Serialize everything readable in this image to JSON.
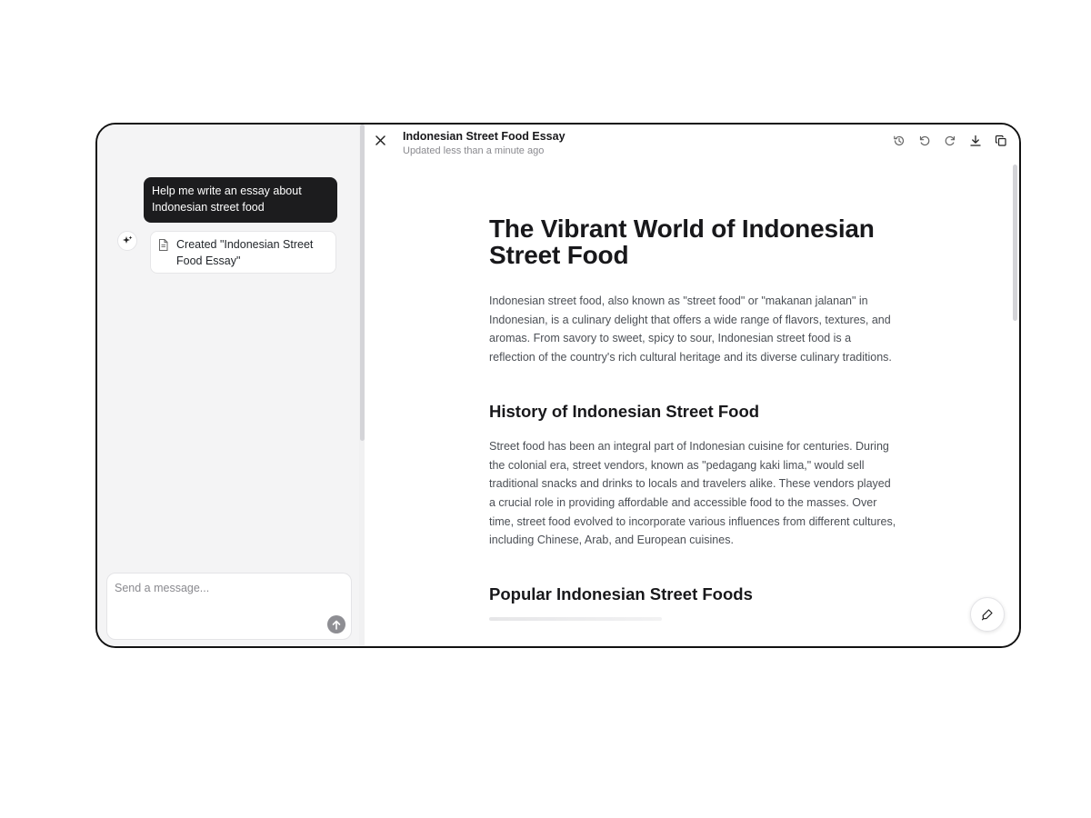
{
  "chat": {
    "user_message": "Help me write an essay about Indonesian street food",
    "artifact_card_label": "Created \"Indonesian Street Food Essay\"",
    "composer_placeholder": "Send a message..."
  },
  "document": {
    "title": "Indonesian Street Food Essay",
    "updated": "Updated less than a minute ago",
    "heading": "The Vibrant World of Indonesian Street Food",
    "sections": [
      {
        "paragraph": "Indonesian street food, also known as \"street food\" or \"makanan jalanan\" in Indonesian, is a culinary delight that offers a wide range of flavors, textures, and aromas. From savory to sweet, spicy to sour, Indonesian street food is a reflection of the country's rich cultural heritage and its diverse culinary traditions."
      },
      {
        "heading": "History of Indonesian Street Food",
        "paragraph": "Street food has been an integral part of Indonesian cuisine for centuries. During the colonial era, street vendors, known as \"pedagang kaki lima,\" would sell traditional snacks and drinks to locals and travelers alike. These vendors played a crucial role in providing affordable and accessible food to the masses. Over time, street food evolved to incorporate various influences from different cultures, including Chinese, Arab, and European cuisines."
      },
      {
        "heading": "Popular Indonesian Street Foods"
      }
    ]
  },
  "icons": {
    "sparkle": "sparkle-icon",
    "document": "document-icon",
    "send": "arrow-up-icon",
    "close": "close-icon",
    "history": "history-icon",
    "undo": "undo-icon",
    "redo": "redo-icon",
    "download": "download-icon",
    "copy": "copy-icon",
    "edit": "pen-icon"
  },
  "colors": {
    "user_bubble": "#1c1c1e",
    "chat_background": "#f4f4f5",
    "send_button": "#8e8e93"
  }
}
